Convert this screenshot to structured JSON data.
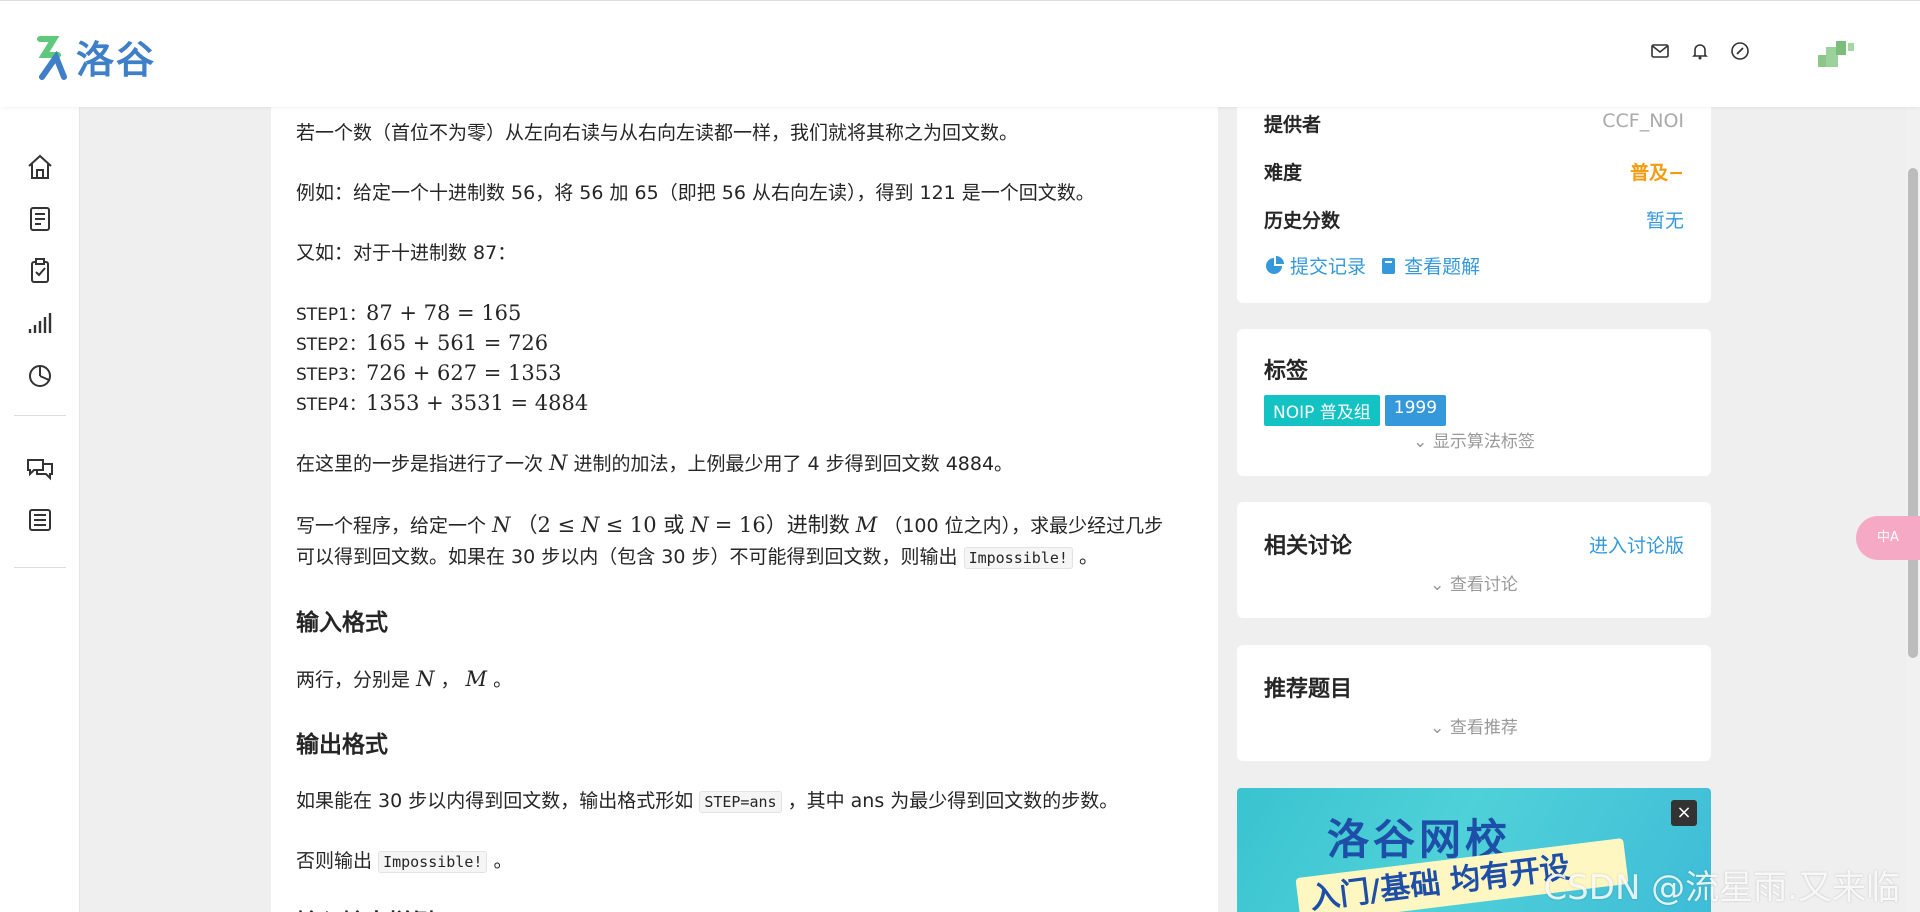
{
  "header": {
    "logo_text": "洛谷"
  },
  "content": {
    "p1": "若一个数（首位不为零）从左向右读与从右向左读都一样，我们就将其称之为回文数。",
    "p2": "例如：给定一个十进制数 56，将 56 加 65（即把 56 从右向左读），得到 121 是一个回文数。",
    "p3": "又如：对于十进制数 87：",
    "steps": [
      {
        "label": "STEP1：",
        "expr": "87 + 78 = 165"
      },
      {
        "label": "STEP2：",
        "expr": "165 + 561 = 726"
      },
      {
        "label": "STEP3：",
        "expr": "726 + 627 = 1353"
      },
      {
        "label": "STEP4：",
        "expr": "1353 + 3531 = 4884"
      }
    ],
    "p4_a": "在这里的一步是指进行了一次",
    "p4_var": "N",
    "p4_b": "进制的加法，上例最少用了 4 步得到回文数 4884。",
    "p5_a": "写一个程序，给定一个",
    "p5_var1": "N",
    "p5_b": "（2 ≤",
    "p5_var2": "N",
    "p5_c": "≤ 10 或",
    "p5_var3": "N",
    "p5_d": "= 16）进制数",
    "p5_var4": "M",
    "p5_e": "（100 位之内），求最少经过几步",
    "p5_line2_a": "可以得到回文数。如果在 30 步以内（包含 30 步）不可能得到回文数，则输出",
    "p5_code": "Impossible!",
    "p5_line2_b": "。",
    "h_input": "输入格式",
    "input_a": "两行，分别是",
    "input_var1": "N",
    "input_b": "，",
    "input_var2": "M",
    "input_c": "。",
    "h_output": "输出格式",
    "output_a": "如果能在 30 步以内得到回文数，输出格式形如",
    "output_code": "STEP=ans",
    "output_b": "，其中 ans 为最少得到回文数的步数。",
    "output2_a": "否则输出",
    "output2_code": "Impossible!",
    "output2_b": "。",
    "h_sample": "输入输出样例"
  },
  "info_card": {
    "provider_label": "提供者",
    "provider_value": "CCF_NOI",
    "difficulty_label": "难度",
    "difficulty_value": "普及−",
    "history_label": "历史分数",
    "history_value": "暂无",
    "submissions_link": "提交记录",
    "solutions_link": "查看题解"
  },
  "tags_card": {
    "title": "标签",
    "tags": [
      {
        "label": "NOIP 普及组",
        "color": "#13c2c2"
      },
      {
        "label": "1999",
        "color": "#3498db"
      }
    ],
    "toggle": "显示算法标签"
  },
  "discuss_card": {
    "title": "相关讨论",
    "enter_link": "进入讨论版",
    "toggle": "查看讨论"
  },
  "recommend_card": {
    "title": "推荐题目",
    "toggle": "查看推荐"
  },
  "ad": {
    "title": "洛谷网校",
    "subtitle": "入门/基础 均有开设",
    "close": "×"
  },
  "translate_button": "中A",
  "watermark": "CSDN @流星雨.又来临",
  "colors": {
    "accent": "#3498db",
    "difficulty": "#f39c11",
    "brand": "#3f7fc7"
  }
}
